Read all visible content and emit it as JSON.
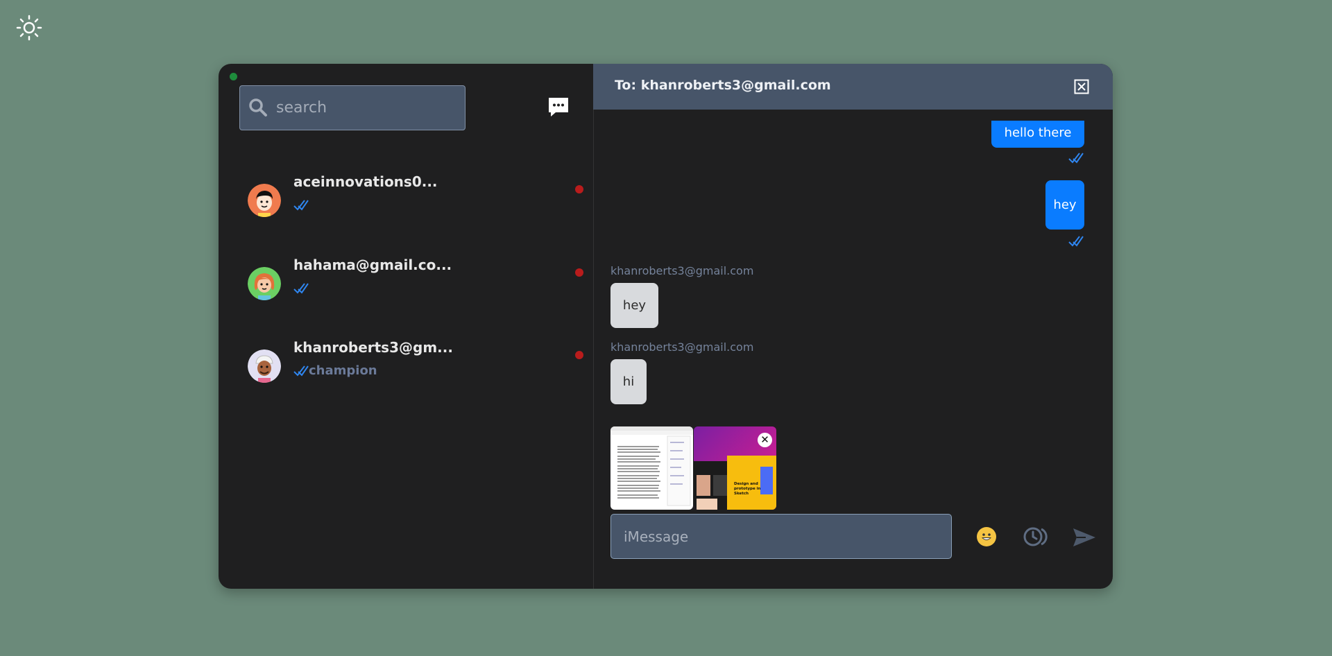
{
  "theme": {
    "toggle_icon": "sun-icon"
  },
  "sidebar": {
    "search": {
      "placeholder": "search",
      "value": ""
    },
    "contacts": [
      {
        "name": "aceinnovations0...",
        "preview": "",
        "avatar_color": "#f07b4e",
        "unread": true
      },
      {
        "name": "hahama@gmail.co...",
        "preview": "",
        "avatar_color": "#6bcf63",
        "unread": true
      },
      {
        "name": "khanroberts3@gm...",
        "preview": "champion",
        "avatar_color": "#e2e0f3",
        "unread": true
      }
    ]
  },
  "chat": {
    "title": "To: khanroberts3@gmail.com",
    "messages": [
      {
        "direction": "out",
        "text": "hello there",
        "read": true
      },
      {
        "direction": "out",
        "text": "hey",
        "read": true
      },
      {
        "direction": "in",
        "sender": "khanroberts3@gmail.com",
        "text": "hey"
      },
      {
        "direction": "in",
        "sender": "khanroberts3@gmail.com",
        "text": "hi"
      }
    ],
    "attachments": [
      {
        "type": "document-screenshot"
      },
      {
        "type": "design-screenshot",
        "text": "Design and prototype in Sketch"
      }
    ],
    "input": {
      "placeholder": "iMessage",
      "value": ""
    }
  },
  "colors": {
    "background": "#6b8a7a",
    "panel": "#1f1f20",
    "header": "#475569",
    "accent_blue": "#0a7cff",
    "unread_red": "#b91c1c",
    "online_green": "#1e8c3c"
  }
}
